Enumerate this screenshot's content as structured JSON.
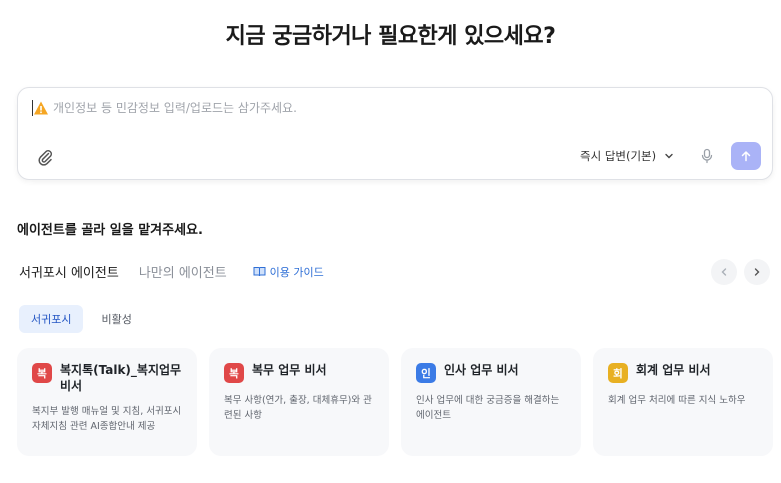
{
  "hero": {
    "title": "지금 궁금하거나 필요한게 있으세요?"
  },
  "composer": {
    "placeholder": "개인정보 등 민감정보 입력/업로드는 삼가주세요.",
    "mode_label": "즉시 답변(기본)",
    "warn_color": "#f5a623",
    "send_color": "#aab3f7"
  },
  "agents": {
    "heading": "에이전트를 골라 일을 맡겨주세요.",
    "tabs": [
      {
        "label": "서귀포시 에이전트"
      },
      {
        "label": "나만의 에이전트"
      }
    ],
    "guide_label": "이용 가이드",
    "sub_tabs": [
      {
        "label": "서귀포시"
      },
      {
        "label": "비활성"
      }
    ],
    "cards": [
      {
        "badge": "복",
        "badge_color": "#e04848",
        "title": "복지톡(Talk)_복지업무 비서",
        "desc": "복지부 발행 매뉴얼 및 지침, 서귀포시 자체지침 관련 AI종합안내 제공"
      },
      {
        "badge": "복",
        "badge_color": "#e04848",
        "title": "복무 업무 비서",
        "desc": "복무 사항(연가, 출장, 대체휴무)와 관련된 사항"
      },
      {
        "badge": "인",
        "badge_color": "#3b7be6",
        "title": "인사 업무 비서",
        "desc": "인사 업무에 대한 궁금증을 해결하는 에이전트"
      },
      {
        "badge": "회",
        "badge_color": "#e8b022",
        "title": "회계 업무 비서",
        "desc": "회계 업무 처리에 따른 지식 노하우"
      }
    ]
  }
}
